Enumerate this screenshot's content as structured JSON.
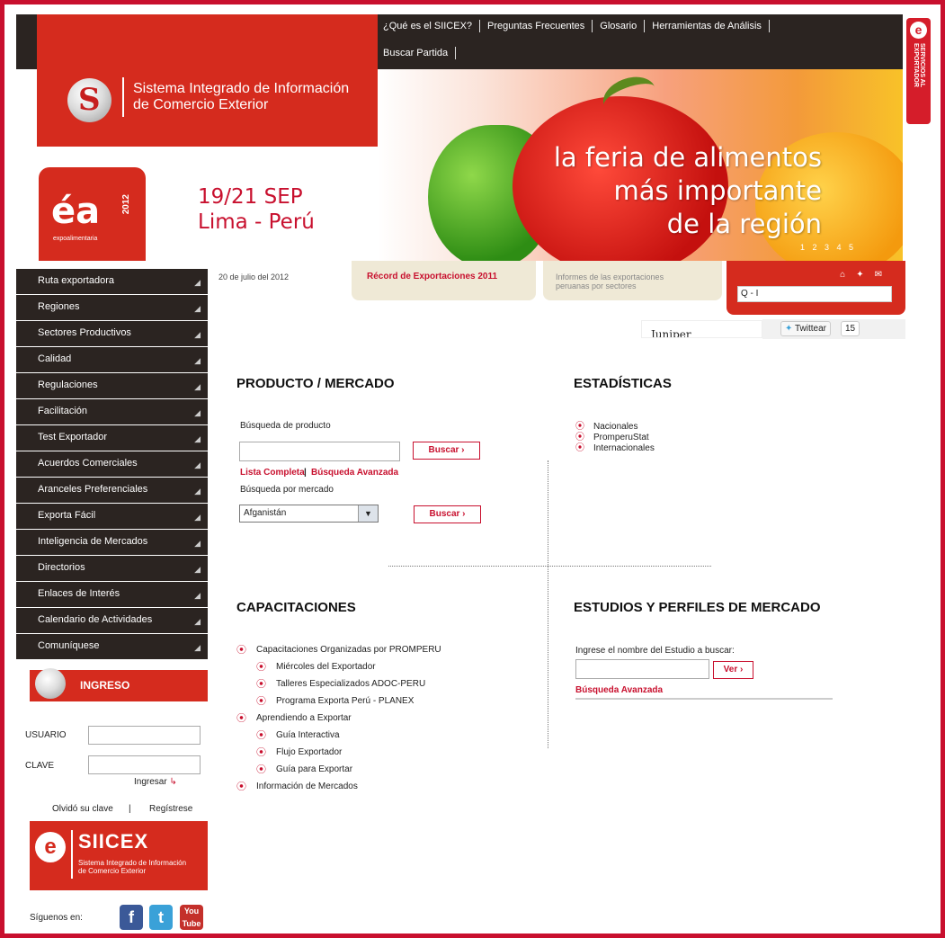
{
  "topnav": [
    "¿Qué es el SIICEX?",
    "Preguntas Frecuentes",
    "Glosario",
    "Herramientas de Análisis",
    "Buscar Partida"
  ],
  "side_tab": {
    "icon": "e",
    "text": "SERVICIOS AL EXPORTADOR"
  },
  "logo": {
    "line1": "Sistema Integrado de Información",
    "line2": "de Comercio Exterior"
  },
  "banner": {
    "expo_logo": "éa",
    "expo_year": "2012",
    "expo_sub": "expoalimentaria",
    "date_line1": "19/21 SEP",
    "date_line2": "Lima - Perú",
    "hero_line1": "la feria de alimentos",
    "hero_line2": "más importante",
    "hero_line3": "de la región",
    "pager": "1 2 3 4 5"
  },
  "sidebar": {
    "items": [
      "Ruta exportadora",
      "Regiones",
      "Sectores Productivos",
      "Calidad",
      "Regulaciones",
      "Facilitación",
      "Test Exportador",
      "Acuerdos Comerciales",
      "Aranceles Preferenciales",
      "Exporta Fácil",
      "Inteligencia de Mercados",
      "Directorios",
      "Enlaces de Interés",
      "Calendario de Actividades",
      "Comuníquese"
    ]
  },
  "login": {
    "title": "INGRESO",
    "user_label": "USUARIO",
    "pass_label": "CLAVE",
    "submit": "Ingresar",
    "forgot": "Olvidó su clave",
    "separator": "|",
    "register": "Regístrese"
  },
  "siicex": {
    "title": "SIICEX",
    "sub1": "Sistema Integrado de Información",
    "sub2": "de Comercio Exterior"
  },
  "social": {
    "label": "Síguenos en:",
    "icons": [
      "facebook-icon",
      "twitter-icon",
      "youtube-icon"
    ]
  },
  "infobar": {
    "date": "20 de julio del 2012",
    "record": "Récord de Exportaciones 2011",
    "informes_line1": "Informes de las exportaciones",
    "informes_line2": "peruanas por sectores",
    "search_prefix": "Q - I"
  },
  "widgets": {
    "juniper": "Juniper",
    "twitter": "Twittear",
    "count": "15"
  },
  "producto": {
    "title": "PRODUCTO / MERCADO",
    "search_label": "Búsqueda de producto",
    "buscar": "Buscar",
    "lista": "Lista Completa",
    "sep": "|",
    "avanzada": "Búsqueda Avanzada",
    "mercado_label": "Búsqueda por mercado",
    "selected_country": "Afganistán"
  },
  "estadisticas": {
    "title": "ESTADÍSTICAS",
    "items": [
      "Nacionales",
      "PromperuStat",
      "Internacionales"
    ]
  },
  "capacitaciones": {
    "title": "CAPACITACIONES",
    "items": [
      {
        "label": "Capacitaciones Organizadas por PROMPERU",
        "level": 0
      },
      {
        "label": "Miércoles del Exportador",
        "level": 1
      },
      {
        "label": "Talleres Especializados ADOC-PERU",
        "level": 1
      },
      {
        "label": "Programa Exporta Perú - PLANEX",
        "level": 1
      },
      {
        "label": "Aprendiendo a Exportar",
        "level": 0
      },
      {
        "label": "Guía Interactiva",
        "level": 1
      },
      {
        "label": "Flujo Exportador",
        "level": 1
      },
      {
        "label": "Guía para Exportar",
        "level": 1
      },
      {
        "label": "Información de Mercados",
        "level": 0
      }
    ]
  },
  "estudios": {
    "title": "ESTUDIOS Y PERFILES DE MERCADO",
    "label": "Ingrese el nombre del Estudio a buscar:",
    "ver": "Ver",
    "avanzada": "Búsqueda Avanzada"
  },
  "colors": {
    "brand_red": "#d52b1e",
    "dark": "#2b2421",
    "beige": "#efe9d6"
  }
}
